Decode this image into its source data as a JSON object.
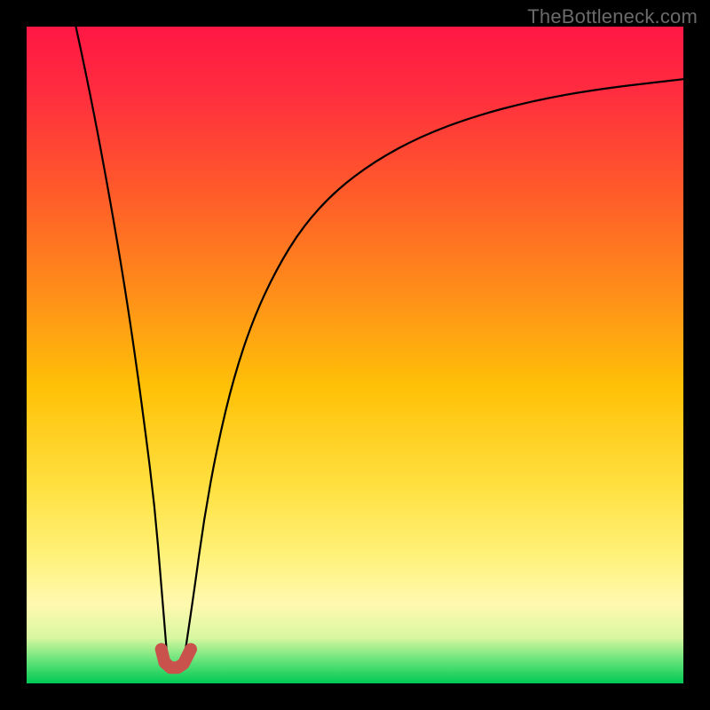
{
  "watermark": "TheBottleneck.com",
  "chart_data": {
    "type": "line",
    "title": "",
    "xlabel": "",
    "ylabel": "",
    "xlim": [
      0,
      100
    ],
    "ylim": [
      0,
      100
    ],
    "gradient_stops": [
      {
        "offset": 0.0,
        "color": "#ff1744"
      },
      {
        "offset": 0.1,
        "color": "#ff2d3f"
      },
      {
        "offset": 0.25,
        "color": "#ff5a2a"
      },
      {
        "offset": 0.4,
        "color": "#ff8c1a"
      },
      {
        "offset": 0.55,
        "color": "#ffc107"
      },
      {
        "offset": 0.7,
        "color": "#ffe040"
      },
      {
        "offset": 0.8,
        "color": "#fff176"
      },
      {
        "offset": 0.88,
        "color": "#fff9b0"
      },
      {
        "offset": 0.93,
        "color": "#d9f7a0"
      },
      {
        "offset": 0.965,
        "color": "#66e47a"
      },
      {
        "offset": 1.0,
        "color": "#00c853"
      }
    ],
    "series": [
      {
        "name": "left-branch",
        "x": [
          7.5,
          9,
          10.5,
          12,
          13.5,
          15,
          16.5,
          18,
          19.5,
          20.5,
          21.3
        ],
        "values": [
          100,
          93,
          85.5,
          77.5,
          69,
          60,
          50,
          39,
          27,
          15,
          5.2
        ]
      },
      {
        "name": "right-branch",
        "x": [
          24.2,
          25.5,
          27,
          29,
          31.5,
          34.5,
          38,
          42,
          47,
          53,
          60,
          68,
          77,
          87,
          100
        ],
        "values": [
          5.2,
          14,
          25,
          36,
          46.5,
          55.5,
          63,
          69.5,
          75,
          79.5,
          83.3,
          86.3,
          88.7,
          90.5,
          92
        ]
      },
      {
        "name": "bottom-marker",
        "type": "path",
        "stroke": "#c9524d",
        "stroke_width": 14,
        "points_xy": [
          [
            20.5,
            5.2
          ],
          [
            21.0,
            3.2
          ],
          [
            21.9,
            2.4
          ],
          [
            23.0,
            2.4
          ],
          [
            23.9,
            3.0
          ],
          [
            24.6,
            4.4
          ],
          [
            25.0,
            5.2
          ]
        ]
      }
    ]
  }
}
